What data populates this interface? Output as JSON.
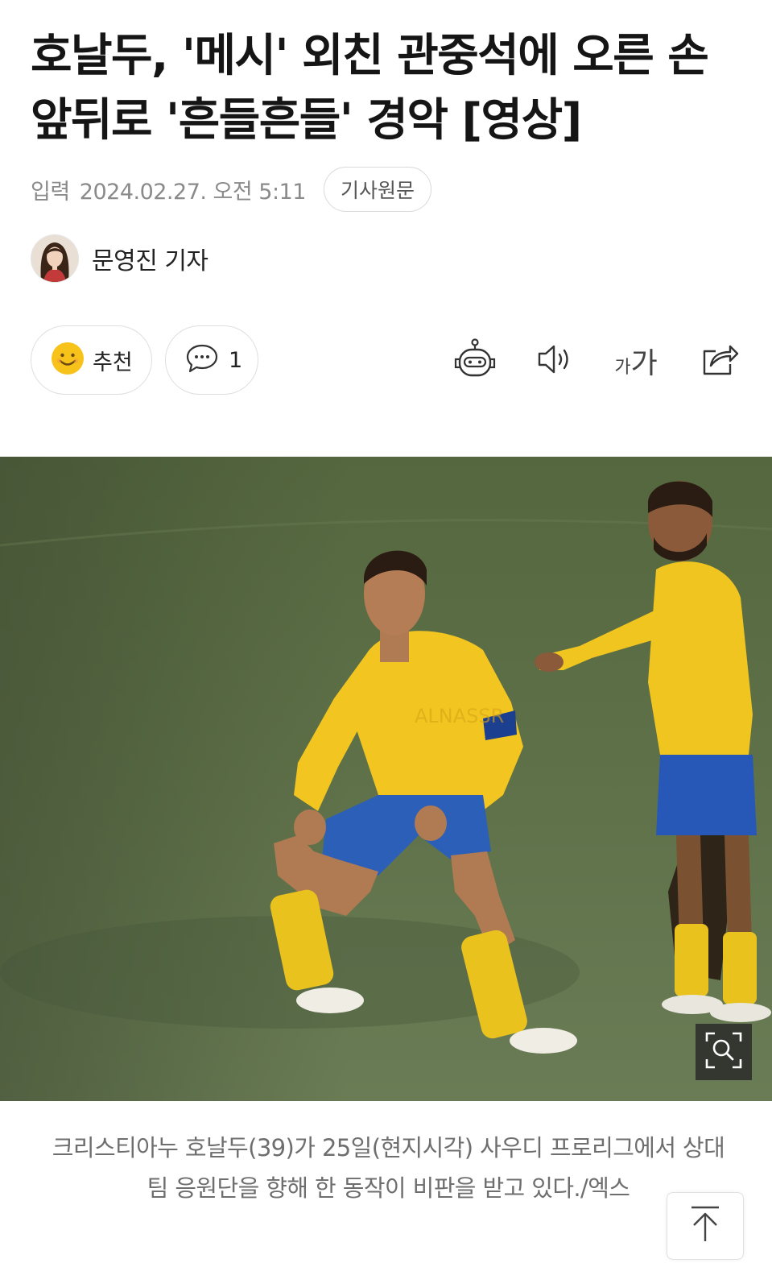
{
  "article": {
    "headline": "호날두, '메시' 외친 관중석에 오른 손 앞뒤로 '흔들흔들' 경악 [영상]",
    "date_label": "입력",
    "date_value": "2024.02.27. 오전 5:11",
    "original_button": "기사원문",
    "author": "문영진 기자"
  },
  "actions": {
    "recommend_label": "추천",
    "comment_count": "1",
    "font_small": "가",
    "font_big": "가"
  },
  "icons": {
    "recommend": "smiley-icon",
    "comment": "speech-bubble-icon",
    "summary_bot": "robot-icon",
    "read_aloud": "speaker-icon",
    "font_size": "font-size-icon",
    "share": "share-icon",
    "zoom": "zoom-search-icon",
    "scroll_top": "arrow-up-icon"
  },
  "photo": {
    "caption": "크리스티아누 호날두(39)가 25일(현지시각) 사우디 프로리그에서 상대팀 응원단을 향해 한 동작이 비판을 받고 있다./엑스"
  },
  "colors": {
    "jersey": "#f2c521",
    "shorts": "#2b5fb8",
    "pitch": "#5d6d4a",
    "smiley": "#f7c21a"
  }
}
